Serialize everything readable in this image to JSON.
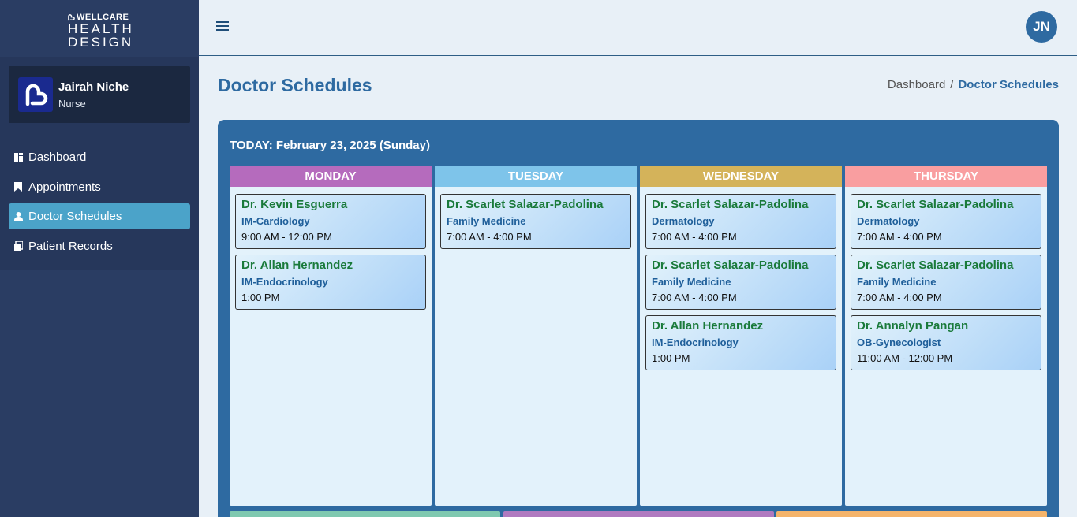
{
  "brand": {
    "top": "WELLCARE",
    "line1": "HEALTH",
    "line2": "DESIGN"
  },
  "user": {
    "name": "Jairah Niche",
    "role": "Nurse",
    "initials": "JN"
  },
  "nav": [
    {
      "label": "Dashboard",
      "icon": "dashboard-icon"
    },
    {
      "label": "Appointments",
      "icon": "bookmark-icon"
    },
    {
      "label": "Doctor Schedules",
      "icon": "doctor-icon"
    },
    {
      "label": "Patient Records",
      "icon": "records-icon"
    }
  ],
  "page": {
    "title": "Doctor Schedules"
  },
  "breadcrumb": {
    "home": "Dashboard",
    "sep": "/",
    "current": "Doctor Schedules"
  },
  "today": "TODAY: February 23, 2025 (Sunday)",
  "colors": {
    "monday": "#b56bbd",
    "tuesday": "#7ec4ea",
    "wednesday": "#d4b35a",
    "thursday": "#f99ea0",
    "accent": "#2e6aa1"
  },
  "days": [
    {
      "name": "MONDAY",
      "entries": [
        {
          "doctor": "Dr. Kevin Esguerra",
          "specialty": "IM-Cardiology",
          "time": "9:00 AM - 12:00 PM"
        },
        {
          "doctor": "Dr. Allan Hernandez",
          "specialty": "IM-Endocrinology",
          "time": "1:00 PM"
        }
      ]
    },
    {
      "name": "TUESDAY",
      "entries": [
        {
          "doctor": "Dr. Scarlet Salazar-Padolina",
          "specialty": "Family Medicine",
          "time": "7:00 AM - 4:00 PM"
        }
      ]
    },
    {
      "name": "WEDNESDAY",
      "entries": [
        {
          "doctor": "Dr. Scarlet Salazar-Padolina",
          "specialty": "Dermatology",
          "time": "7:00 AM - 4:00 PM"
        },
        {
          "doctor": "Dr. Scarlet Salazar-Padolina",
          "specialty": "Family Medicine",
          "time": "7:00 AM - 4:00 PM"
        },
        {
          "doctor": "Dr. Allan Hernandez",
          "specialty": "IM-Endocrinology",
          "time": "1:00 PM"
        }
      ]
    },
    {
      "name": "THURSDAY",
      "entries": [
        {
          "doctor": "Dr. Scarlet Salazar-Padolina",
          "specialty": "Dermatology",
          "time": "7:00 AM - 4:00 PM"
        },
        {
          "doctor": "Dr. Scarlet Salazar-Padolina",
          "specialty": "Family Medicine",
          "time": "7:00 AM - 4:00 PM"
        },
        {
          "doctor": "Dr. Annalyn Pangan",
          "specialty": "OB-Gynecologist",
          "time": "11:00 AM - 12:00 PM"
        }
      ]
    }
  ]
}
